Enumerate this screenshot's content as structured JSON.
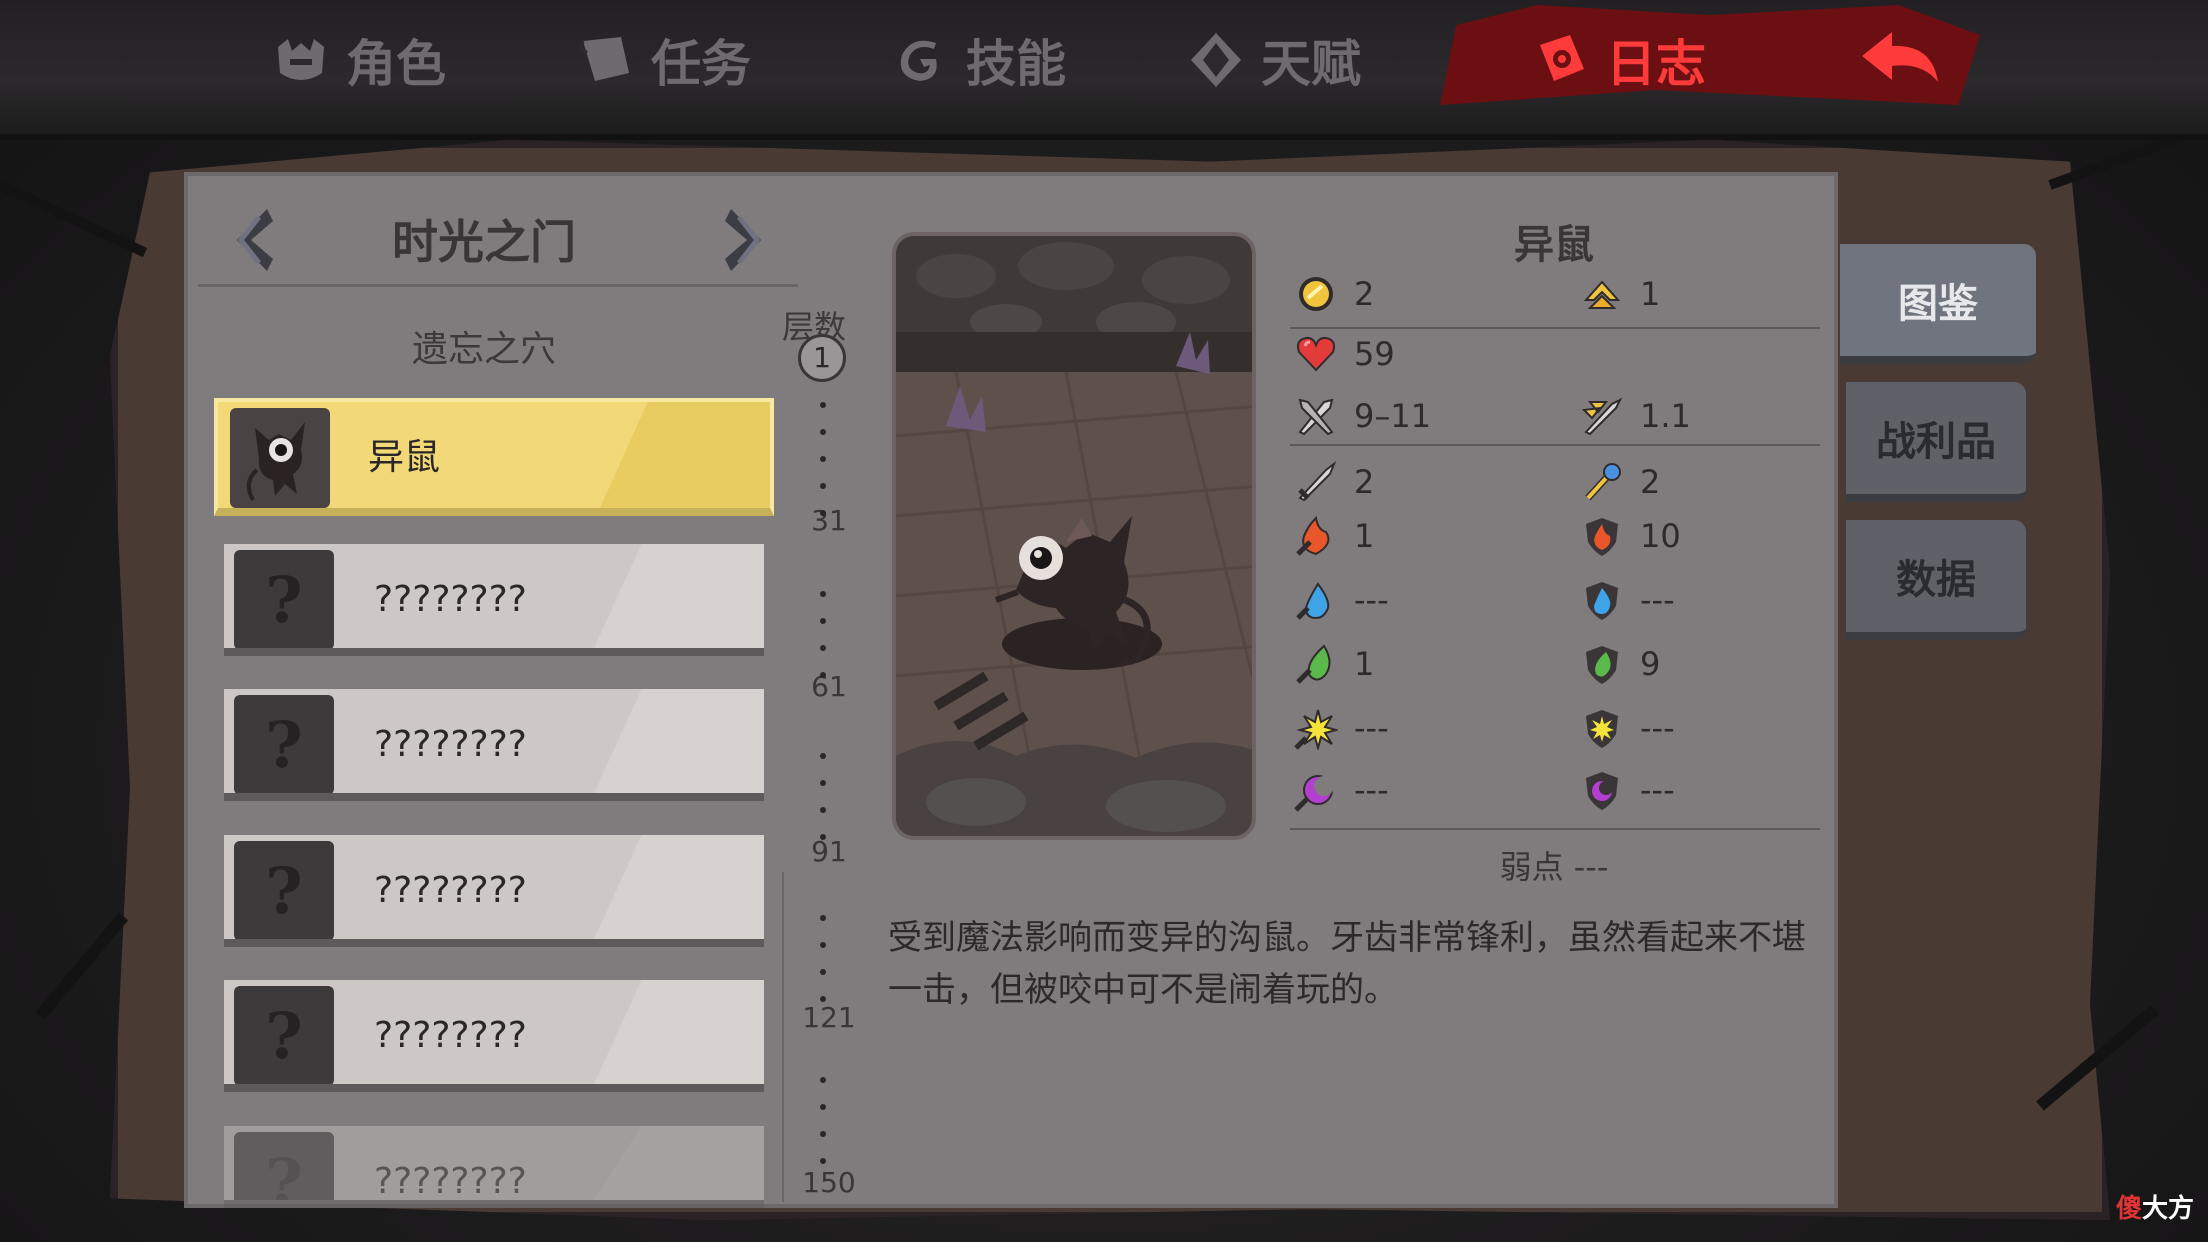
{
  "tabs": [
    {
      "label": "角色",
      "icon": "helmet-icon",
      "active": false
    },
    {
      "label": "任务",
      "icon": "scroll-icon",
      "active": false
    },
    {
      "label": "技能",
      "icon": "swirl-icon",
      "active": false
    },
    {
      "label": "天赋",
      "icon": "diamond-icon",
      "active": false
    },
    {
      "label": "日志",
      "icon": "tome-icon",
      "active": true
    }
  ],
  "back_icon": "back-arrow-icon",
  "location": {
    "title": "时光之门",
    "subtitle": "遗忘之穴"
  },
  "floors": {
    "label": "层数",
    "current": "1",
    "marks": [
      "31",
      "61",
      "91",
      "121",
      "150"
    ]
  },
  "entries": [
    {
      "name": "异鼠",
      "known": true
    },
    {
      "name": "????????",
      "known": false
    },
    {
      "name": "????????",
      "known": false
    },
    {
      "name": "????????",
      "known": false
    },
    {
      "name": "????????",
      "known": false
    },
    {
      "name": "????????",
      "known": false
    }
  ],
  "detail": {
    "name": "异鼠",
    "gold": "2",
    "level": "1",
    "hp": "59",
    "attack": "9–11",
    "attack_speed": "1.1",
    "phys_atk": "2",
    "phys_def": "2",
    "fire_atk": "1",
    "fire_def": "10",
    "water_atk": "---",
    "water_def": "---",
    "earth_atk": "1",
    "earth_def": "9",
    "light_atk": "---",
    "light_def": "---",
    "dark_atk": "---",
    "dark_def": "---",
    "weakness": "弱点 ---",
    "description": "受到魔法影响而变异的沟鼠。牙齿非常锋利，虽然看起来不堪一击，但被咬中可不是闹着玩的。"
  },
  "side_tabs": [
    "图鉴",
    "战利品",
    "数据"
  ],
  "watermark": {
    "part1": "傻",
    "part2": "大方"
  },
  "colors": {
    "active_tab": "#ff3a3a",
    "selected_card": "#f2d876",
    "panel": "#807b7c"
  }
}
